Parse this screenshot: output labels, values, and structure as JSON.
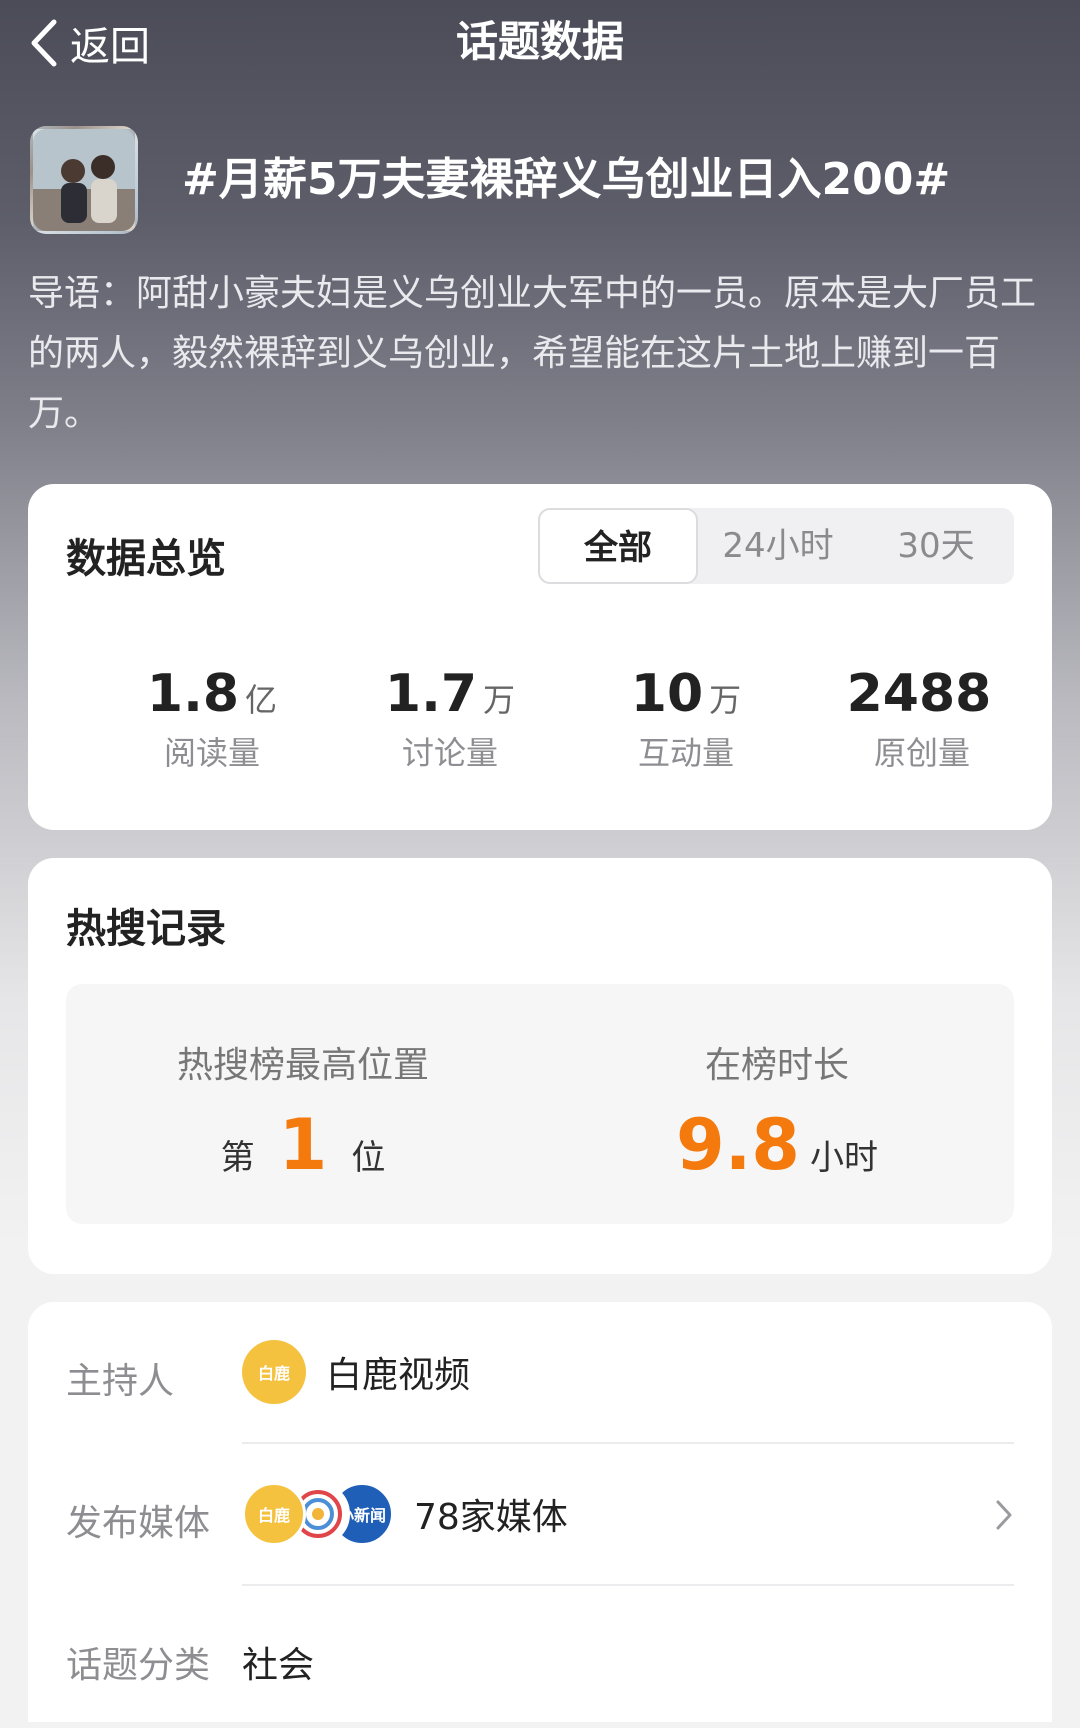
{
  "header": {
    "back_label": "返回",
    "title": "话题数据"
  },
  "topic": {
    "title": "#月薪5万夫妻裸辞义乌创业日入200#",
    "intro": "导语：阿甜小豪夫妇是义乌创业大军中的一员。原本是大厂员工的两人，毅然裸辞到义乌创业，希望能在这片土地上赚到一百万。"
  },
  "overview": {
    "title": "数据总览",
    "tabs": [
      "全部",
      "24小时",
      "30天"
    ],
    "active_tab": "全部",
    "stats": [
      {
        "value": "1.8",
        "unit": "亿",
        "label": "阅读量"
      },
      {
        "value": "1.7",
        "unit": "万",
        "label": "讨论量"
      },
      {
        "value": "10",
        "unit": "万",
        "label": "互动量"
      },
      {
        "value": "2488",
        "unit": "",
        "label": "原创量"
      }
    ]
  },
  "hot": {
    "title": "热搜记录",
    "peak_label": "热搜榜最高位置",
    "peak_prefix": "第",
    "peak_value": "1",
    "peak_suffix": "位",
    "duration_label": "在榜时长",
    "duration_value": "9.8",
    "duration_unit": "小时"
  },
  "info": {
    "host_label": "主持人",
    "host_name": "白鹿视频",
    "host_avatar_text": "白鹿",
    "media_label": "发布媒体",
    "media_avatars": [
      "白鹿",
      "",
      "小新闻"
    ],
    "media_count": "78家媒体",
    "category_label": "话题分类",
    "category_value": "社会"
  },
  "colors": {
    "accent_orange": "#f47a0e",
    "host_avatar": "#f5c23f",
    "media_blue": "#1f5fb8"
  }
}
